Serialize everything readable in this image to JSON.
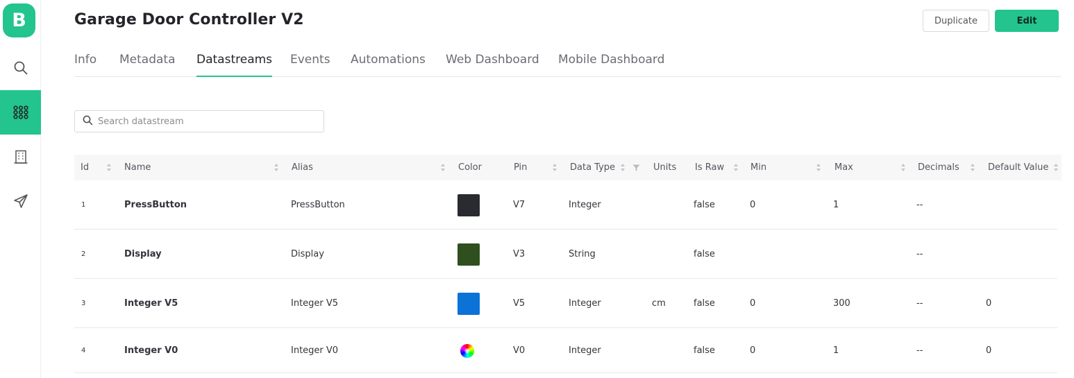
{
  "logo": {
    "letter": "B"
  },
  "sidebar": {
    "items": [
      {
        "name": "search",
        "icon": "search-icon",
        "active": false
      },
      {
        "name": "templates",
        "icon": "grid-icon",
        "active": true
      },
      {
        "name": "organizations",
        "icon": "building-icon",
        "active": false
      },
      {
        "name": "send",
        "icon": "send-icon",
        "active": false
      }
    ]
  },
  "header": {
    "title": "Garage Door Controller V2",
    "duplicate_label": "Duplicate",
    "edit_label": "Edit"
  },
  "tabs": [
    {
      "label": "Info",
      "active": false
    },
    {
      "label": "Metadata",
      "active": false
    },
    {
      "label": "Datastreams",
      "active": true
    },
    {
      "label": "Events",
      "active": false
    },
    {
      "label": "Automations",
      "active": false
    },
    {
      "label": "Web Dashboard",
      "active": false
    },
    {
      "label": "Mobile Dashboard",
      "active": false
    }
  ],
  "search": {
    "placeholder": "Search datastream",
    "value": ""
  },
  "table": {
    "columns": [
      "Id",
      "Name",
      "Alias",
      "Color",
      "Pin",
      "Data Type",
      "Units",
      "Is Raw",
      "Min",
      "Max",
      "Decimals",
      "Default Value"
    ],
    "rows": [
      {
        "id": "1",
        "name": "PressButton",
        "alias": "PressButton",
        "color": "#2a2b30",
        "pin": "V7",
        "data_type": "Integer",
        "units": "",
        "is_raw": "false",
        "min": "0",
        "max": "1",
        "decimals": "--",
        "default_value": ""
      },
      {
        "id": "2",
        "name": "Display",
        "alias": "Display",
        "color": "#2f4f1f",
        "pin": "V3",
        "data_type": "String",
        "units": "",
        "is_raw": "false",
        "min": "",
        "max": "",
        "decimals": "--",
        "default_value": ""
      },
      {
        "id": "3",
        "name": "Integer V5",
        "alias": "Integer V5",
        "color": "#0b72d8",
        "pin": "V5",
        "data_type": "Integer",
        "units": "cm",
        "is_raw": "false",
        "min": "0",
        "max": "300",
        "decimals": "--",
        "default_value": "0"
      },
      {
        "id": "4",
        "name": "Integer V0",
        "alias": "Integer V0",
        "color": "multicolor",
        "pin": "V0",
        "data_type": "Integer",
        "units": "",
        "is_raw": "false",
        "min": "0",
        "max": "1",
        "decimals": "--",
        "default_value": "0"
      }
    ]
  },
  "colors": {
    "accent": "#23c48e",
    "text": "#24252b",
    "muted": "#6b6c73"
  }
}
